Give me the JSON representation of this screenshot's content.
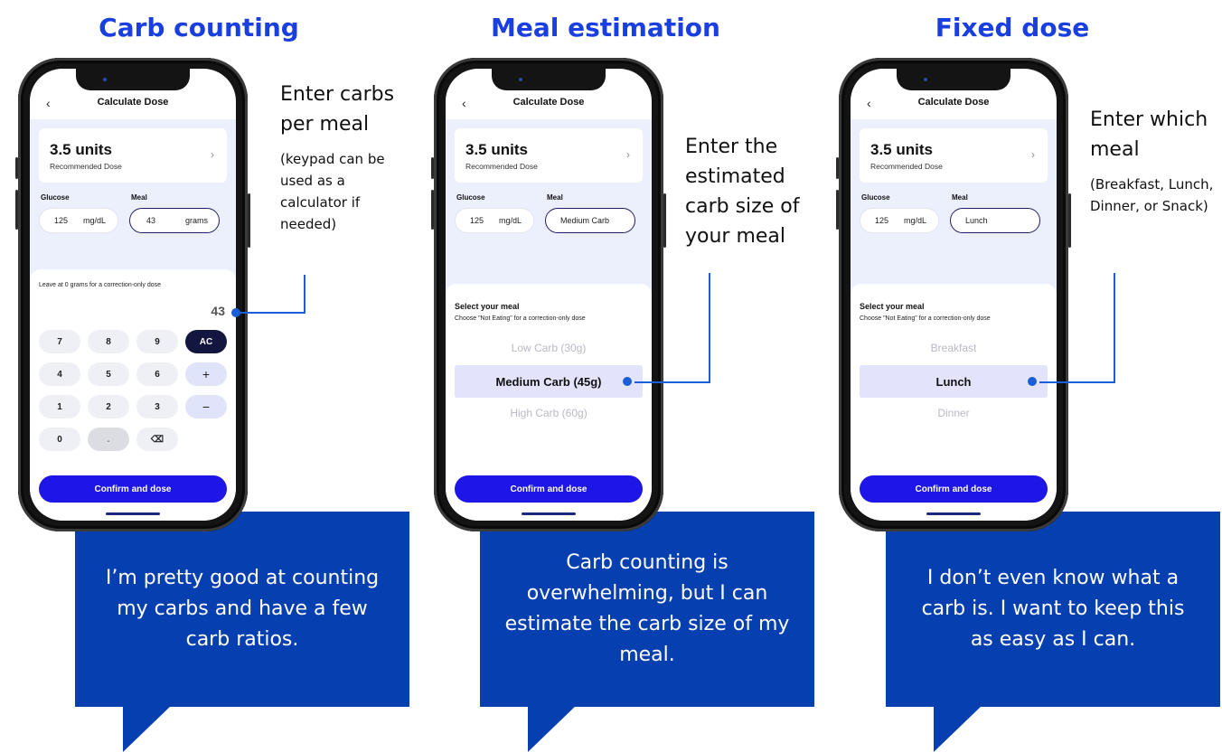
{
  "columns": [
    {
      "title": "Carb counting",
      "phone": {
        "nav_back": "‹",
        "nav_title": "Calculate Dose",
        "dose_value": "3.5 units",
        "dose_label": "Recommended Dose",
        "glucose_label": "Glucose",
        "glucose_value": "125",
        "glucose_unit": "mg/dL",
        "meal_label": "Meal",
        "meal_value": "43",
        "meal_unit": "grams",
        "hint": "Leave at 0 grams for a correction-only dose",
        "entry": "43",
        "keys": [
          "7",
          "8",
          "9",
          "AC",
          "4",
          "5",
          "6",
          "+",
          "1",
          "2",
          "3",
          "−",
          "0",
          ".",
          "⌫"
        ],
        "cta": "Confirm and dose"
      },
      "annotation": {
        "main": "Enter carbs per meal",
        "detail": "(keypad can be used as a calculator if needed)"
      },
      "quote": "I’m pretty good at counting my carbs and have a few carb ratios."
    },
    {
      "title": "Meal estimation",
      "phone": {
        "nav_back": "‹",
        "nav_title": "Calculate Dose",
        "dose_value": "3.5 units",
        "dose_label": "Recommended Dose",
        "glucose_label": "Glucose",
        "glucose_value": "125",
        "glucose_unit": "mg/dL",
        "meal_label": "Meal",
        "meal_value": "Medium Carb",
        "sheet_title": "Select your meal",
        "sheet_subtitle": "Choose \"Not Eating\" for a correction-only dose",
        "options": [
          "Low Carb (30g)",
          "Medium Carb (45g)",
          "High Carb (60g)"
        ],
        "selected": "Medium Carb (45g)",
        "cta": "Confirm and dose"
      },
      "annotation": {
        "main": "Enter the estimated carb size of your meal",
        "detail": ""
      },
      "quote": "Carb counting is overwhelming, but I can estimate the carb size of my meal."
    },
    {
      "title": "Fixed dose",
      "phone": {
        "nav_back": "‹",
        "nav_title": "Calculate Dose",
        "dose_value": "3.5 units",
        "dose_label": "Recommended Dose",
        "glucose_label": "Glucose",
        "glucose_value": "125",
        "glucose_unit": "mg/dL",
        "meal_label": "Meal",
        "meal_value": "Lunch",
        "sheet_title": "Select your meal",
        "sheet_subtitle": "Choose \"Not Eating\" for a correction-only dose",
        "options": [
          "Breakfast",
          "Lunch",
          "Dinner"
        ],
        "selected": "Lunch",
        "cta": "Confirm and dose"
      },
      "annotation": {
        "main": "Enter which meal",
        "detail": "(Breakfast, Lunch, Dinner, or Snack)"
      },
      "quote": "I don’t even know what a carb is. I want to keep this as easy as I can."
    }
  ],
  "colors": {
    "title_blue": "#1a3fe0",
    "callout_blue": "#063fb0",
    "cta_blue": "#1d16e6",
    "leader_blue": "#1a5fd8"
  }
}
